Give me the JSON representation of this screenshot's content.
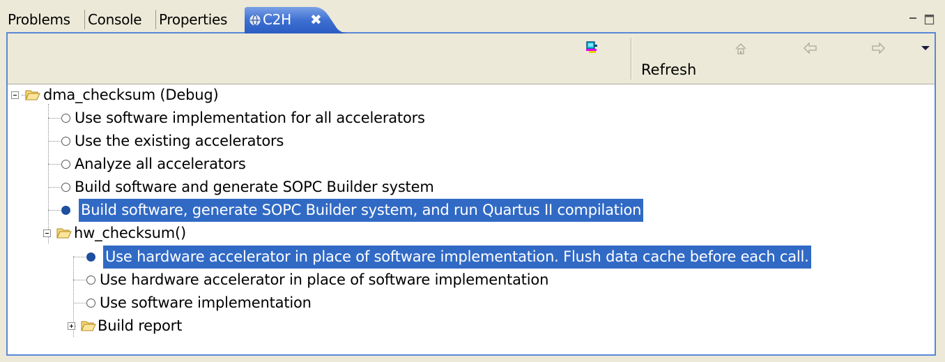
{
  "tabs": {
    "problems": "Problems",
    "console": "Console",
    "properties": "Properties",
    "active": "C2H",
    "active_close": "✖"
  },
  "toolbar": {
    "refresh_label": "Refresh",
    "icons": [
      "c2h-launch-icon",
      "home-icon",
      "back-arrow-icon",
      "forward-arrow-icon",
      "view-menu-icon"
    ]
  },
  "tree": {
    "root": {
      "label": "dma_checksum (Debug)",
      "expanded": true
    },
    "root_options": [
      {
        "label": "Use software implementation for all accelerators",
        "checked": false
      },
      {
        "label": "Use the existing accelerators",
        "checked": false
      },
      {
        "label": "Analyze all accelerators",
        "checked": false
      },
      {
        "label": "Build software and generate SOPC Builder system",
        "checked": false
      },
      {
        "label": "Build software, generate SOPC Builder system, and run Quartus II compilation",
        "checked": true,
        "selected": true
      }
    ],
    "function": {
      "label": "hw_checksum()",
      "expanded": true
    },
    "function_options": [
      {
        "label": "Use hardware accelerator in place of software implementation. Flush data cache before each call.",
        "checked": true,
        "selected": true
      },
      {
        "label": "Use hardware accelerator in place of software implementation",
        "checked": false
      },
      {
        "label": "Use software implementation",
        "checked": false
      }
    ],
    "report": {
      "label": "Build report",
      "expanded": false
    }
  },
  "colors": {
    "selection": "#316ac5",
    "active_tab": "#3c6ed0",
    "frame_border": "#5a87d6",
    "chrome": "#ece9d8"
  }
}
